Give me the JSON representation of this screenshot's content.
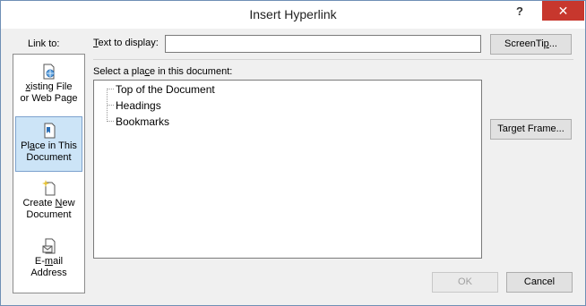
{
  "window": {
    "title": "Insert Hyperlink",
    "help_glyph": "?",
    "close_glyph": "✕"
  },
  "link_to": {
    "label": "Link to:",
    "items": [
      {
        "pre": "",
        "u": "x",
        "post": "isting File",
        "line2": "or Web Page",
        "full": "Existing File or Web Page",
        "icon": "file-globe-icon",
        "selected": false
      },
      {
        "pre": "Pl",
        "u": "a",
        "post": "ce in This",
        "line2": "Document",
        "full": "Place in This Document",
        "icon": "document-bookmark-icon",
        "selected": true
      },
      {
        "pre": "Create ",
        "u": "N",
        "post": "ew",
        "line2": "Document",
        "full": "Create New Document",
        "icon": "new-document-icon",
        "selected": false
      },
      {
        "pre": "E-",
        "u": "m",
        "post": "ail",
        "line2": "Address",
        "full": "E-mail Address",
        "icon": "email-icon",
        "selected": false
      }
    ]
  },
  "text_to_display": {
    "label_u": "T",
    "label_rest": "ext to display:",
    "value": ""
  },
  "buttons": {
    "screentip_pre": "ScreenTi",
    "screentip_u": "p",
    "screentip_post": "...",
    "target_pre": "Tar",
    "target_u": "g",
    "target_post": "et Frame...",
    "ok": "OK",
    "cancel": "Cancel"
  },
  "place": {
    "label_pre": "Select a pla",
    "label_u": "c",
    "label_post": "e in this document:",
    "tree": [
      "Top of the Document",
      "Headings",
      "Bookmarks"
    ]
  },
  "colors": {
    "selected_bg": "#cce4f7",
    "close_red": "#c7372d",
    "icon_blue": "#2b6fb6",
    "icon_yellow": "#e8c53a"
  }
}
